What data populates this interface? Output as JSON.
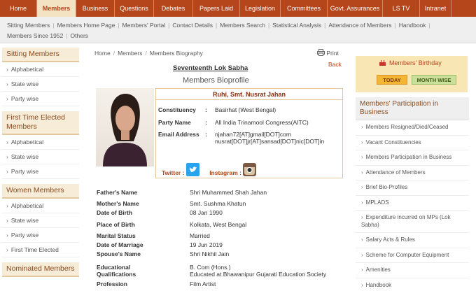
{
  "topnav": [
    "Home",
    "Members",
    "Business",
    "Questions",
    "Debates",
    "Papers Laid",
    "Legislation",
    "Committees",
    "Govt. Assurances",
    "LS TV",
    "Intranet"
  ],
  "subnav": [
    "Sitting Members",
    "Members Home Page",
    "Members' Portal",
    "Contact Details",
    "Members Search",
    "Statistical Analysis",
    "Attendance of Members",
    "Handbook",
    "Members Since 1952",
    "Others"
  ],
  "sidebar": [
    {
      "title": "Sitting Members",
      "items": [
        "Alphabetical",
        "State wise",
        "Party wise"
      ]
    },
    {
      "title": "First Time Elected Members",
      "items": [
        "Alphabetical",
        "State wise",
        "Party wise"
      ]
    },
    {
      "title": "Women Members",
      "items": [
        "Alphabetical",
        "State wise",
        "Party wise",
        "First Time Elected"
      ]
    },
    {
      "title": "Nominated Members",
      "items": []
    }
  ],
  "breadcrumb": [
    "Home",
    "Members",
    "Members Biography"
  ],
  "print_label": "Print",
  "back_label": "Back",
  "lok_sabha": "Seventeenth Lok Sabha",
  "bio_title": "Members Bioprofile",
  "member": {
    "name": "Ruhi, Smt. Nusrat Jahan",
    "constituency_label": "Constituency",
    "constituency": "Basirhat (West Bengal)",
    "party_label": "Party Name",
    "party": "All India Trinamool Congress(AITC)",
    "email_label": "Email Address",
    "email1": "njahan72[AT]gmail[DOT]com",
    "email2": "nusrat[DOT]jr[AT]sansad[DOT]nic[DOT]in",
    "twitter_label": "Twitter :",
    "instagram_label": "Instagram :"
  },
  "details": [
    {
      "k": "Father's Name",
      "v": [
        "Shri Muhammed Shah Jahan"
      ]
    },
    {
      "k": "Mother's Name",
      "v": [
        "Smt. Sushma Khatun"
      ]
    },
    {
      "k": "Date of Birth",
      "v": [
        "08 Jan 1990"
      ]
    },
    {
      "k": "Place of Birth",
      "v": [
        "Kolkata, West Bengal"
      ]
    },
    {
      "k": "Marital Status",
      "v": [
        "Married"
      ]
    },
    {
      "k": "Date of Marriage",
      "v": [
        "19 Jun 2019"
      ]
    },
    {
      "k": "Spouse's Name",
      "v": [
        "Shri Nikhil Jain"
      ]
    },
    {
      "k": "Educational Qualifications",
      "v": [
        "B. Com (Hons.)",
        "Educated at Bhawanipur Gujarati Education Society"
      ]
    },
    {
      "k": "Profession",
      "v": [
        "Film Artist"
      ]
    }
  ],
  "birthday": {
    "title": "Members' Birthday",
    "today": "TODAY",
    "month": "MONTH WISE"
  },
  "participation": {
    "title": "Members' Participation in Business",
    "items": [
      "Members Resigned/Died/Ceased",
      "Vacant Constituencies",
      "Members Participation in Business",
      "Attendance of Members",
      "Brief Bio-Profiles",
      "MPLADS",
      "Expenditure incurred on MPs (Lok Sabha)",
      "Salary Acts & Rules",
      "Scheme for Computer Equipment",
      "Amenities",
      "Handbook"
    ]
  },
  "colors": {
    "brand": "#b5451b",
    "active_tab_bg": "#f3e3c3"
  }
}
